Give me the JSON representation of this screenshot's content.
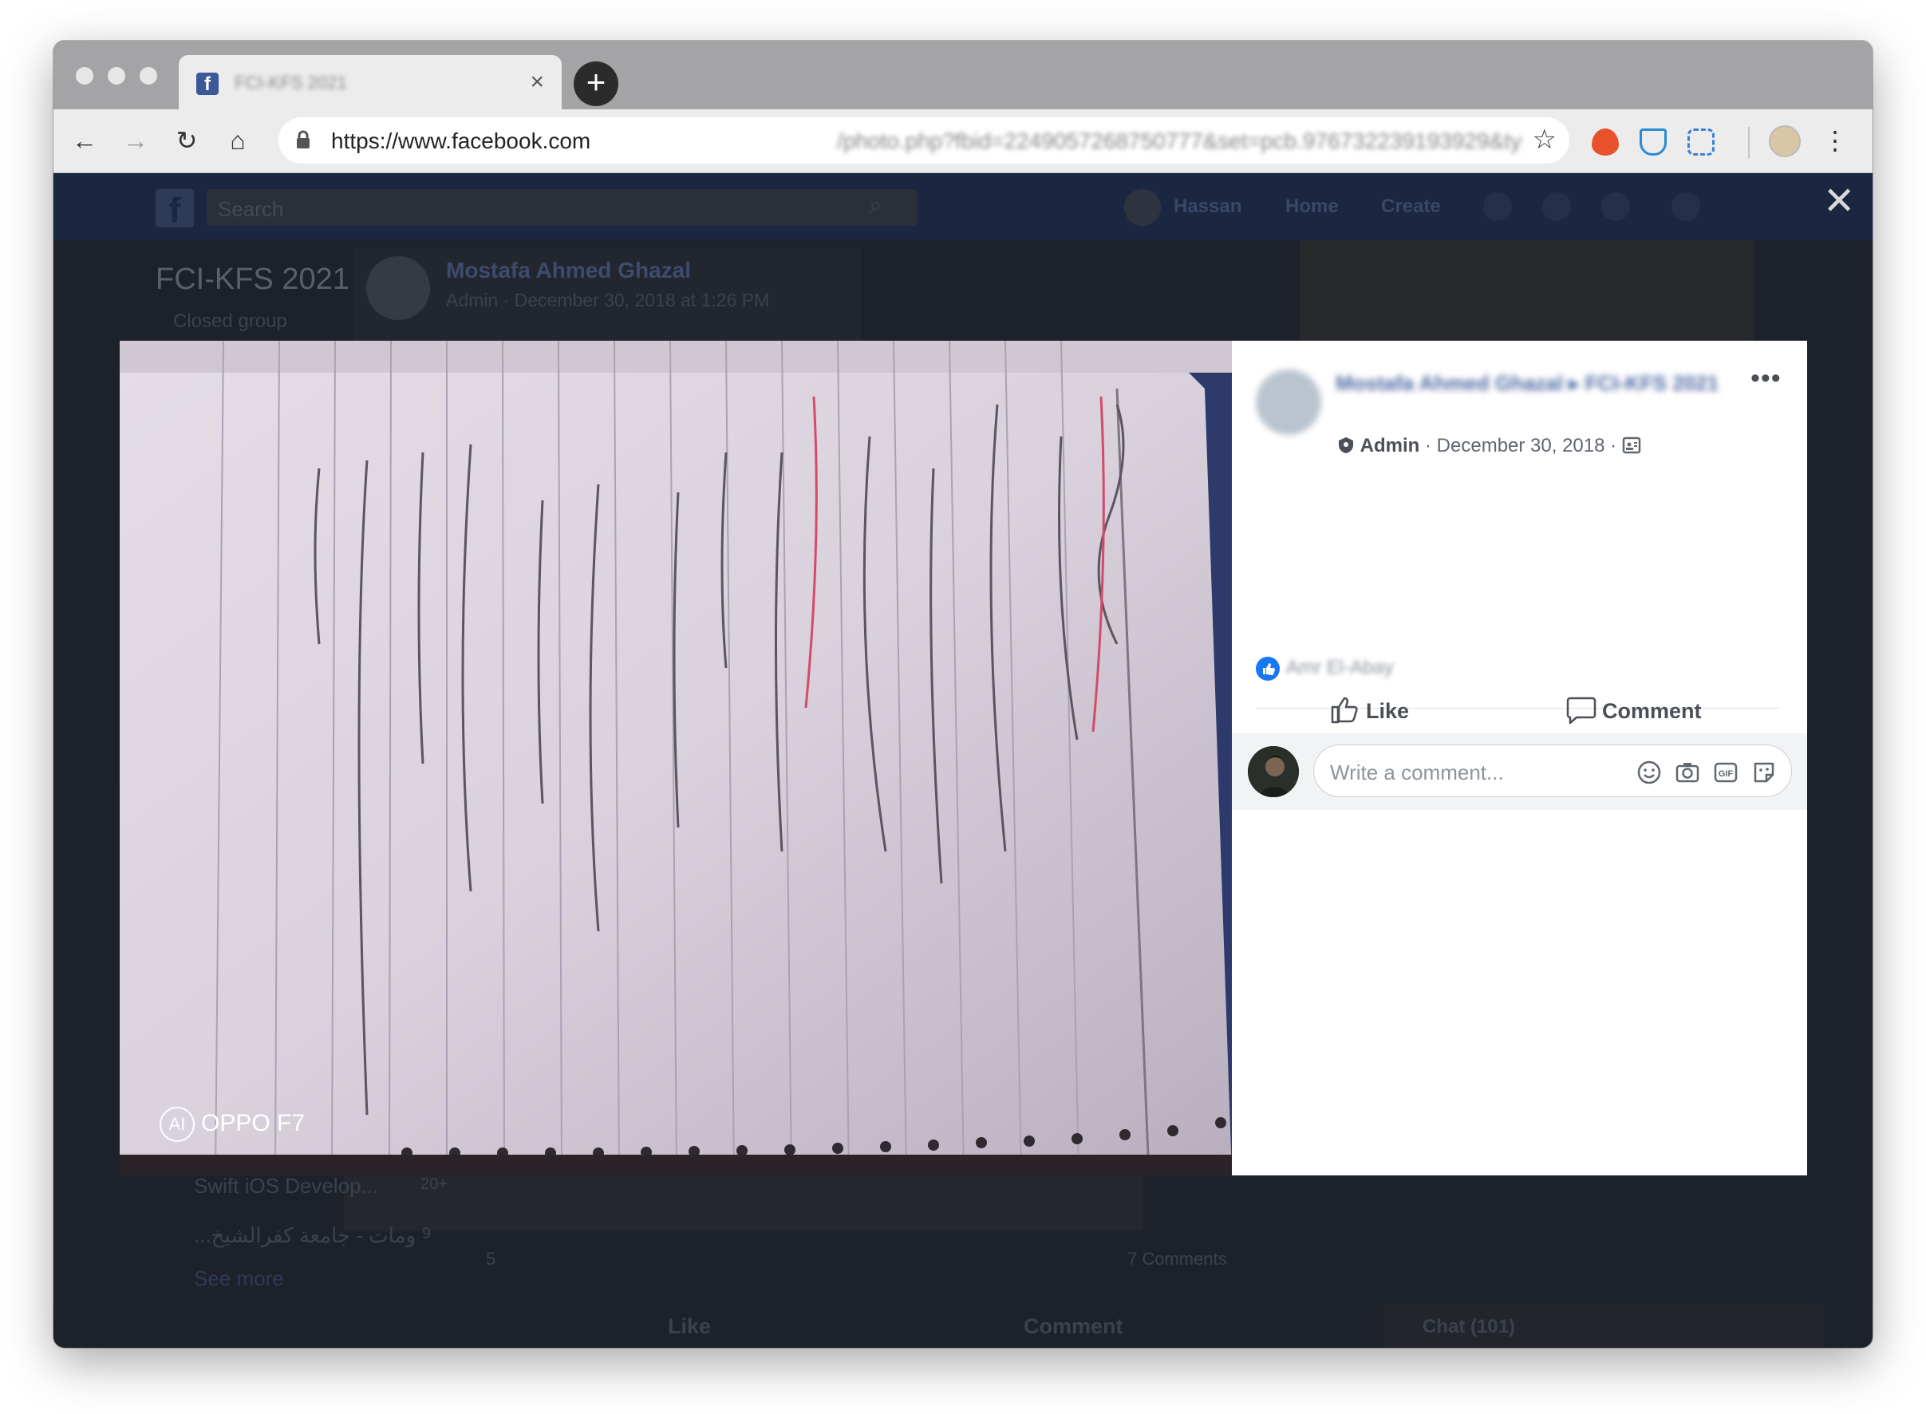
{
  "browser": {
    "tab_title": "FCI-KFS 2021",
    "tab_close": "×",
    "new_tab": "+",
    "url_domain": "https://www.facebook.com",
    "url_path": "/photo.php?fbid=2249057268750777&set=pcb.976732239193929&type=3&theater..."
  },
  "facebook": {
    "search_placeholder": "Search",
    "nav": {
      "user": "Hassan",
      "home": "Home",
      "create": "Create"
    },
    "group_title": "FCI-KFS 2021",
    "group_type": "Closed group",
    "post_author": "Mostafa Ahmed Ghazal",
    "post_meta": "Admin · December 30, 2018 at 1:26 PM",
    "sidebar_1": "Swift iOS Develop...",
    "sidebar_1_count": "20+",
    "sidebar_2": "...ومات - جامعة كفرالشيخ",
    "sidebar_2_count": "9",
    "see_more": "See more",
    "reactions_count": "5",
    "comments_count": "7 Comments",
    "like_label": "Like",
    "comment_label": "Comment",
    "chat_label": "Chat (101)"
  },
  "photo": {
    "watermark_ai": "AI",
    "watermark": "OPPO F7"
  },
  "panel": {
    "author": "Mostafa Ahmed Ghazal ▸ FCI-KFS 2021",
    "role": "Admin",
    "date": " · December 30, 2018 · ",
    "liker": "Amr El-Abay",
    "like_button": "Like",
    "comment_button": "Comment",
    "comment_placeholder": "Write a comment...",
    "more": "•••"
  },
  "close_icon": "✕",
  "colors": {
    "fb_blue": "#1877f2",
    "fb_bar": "#1b2640",
    "link": "#4b67a1"
  }
}
